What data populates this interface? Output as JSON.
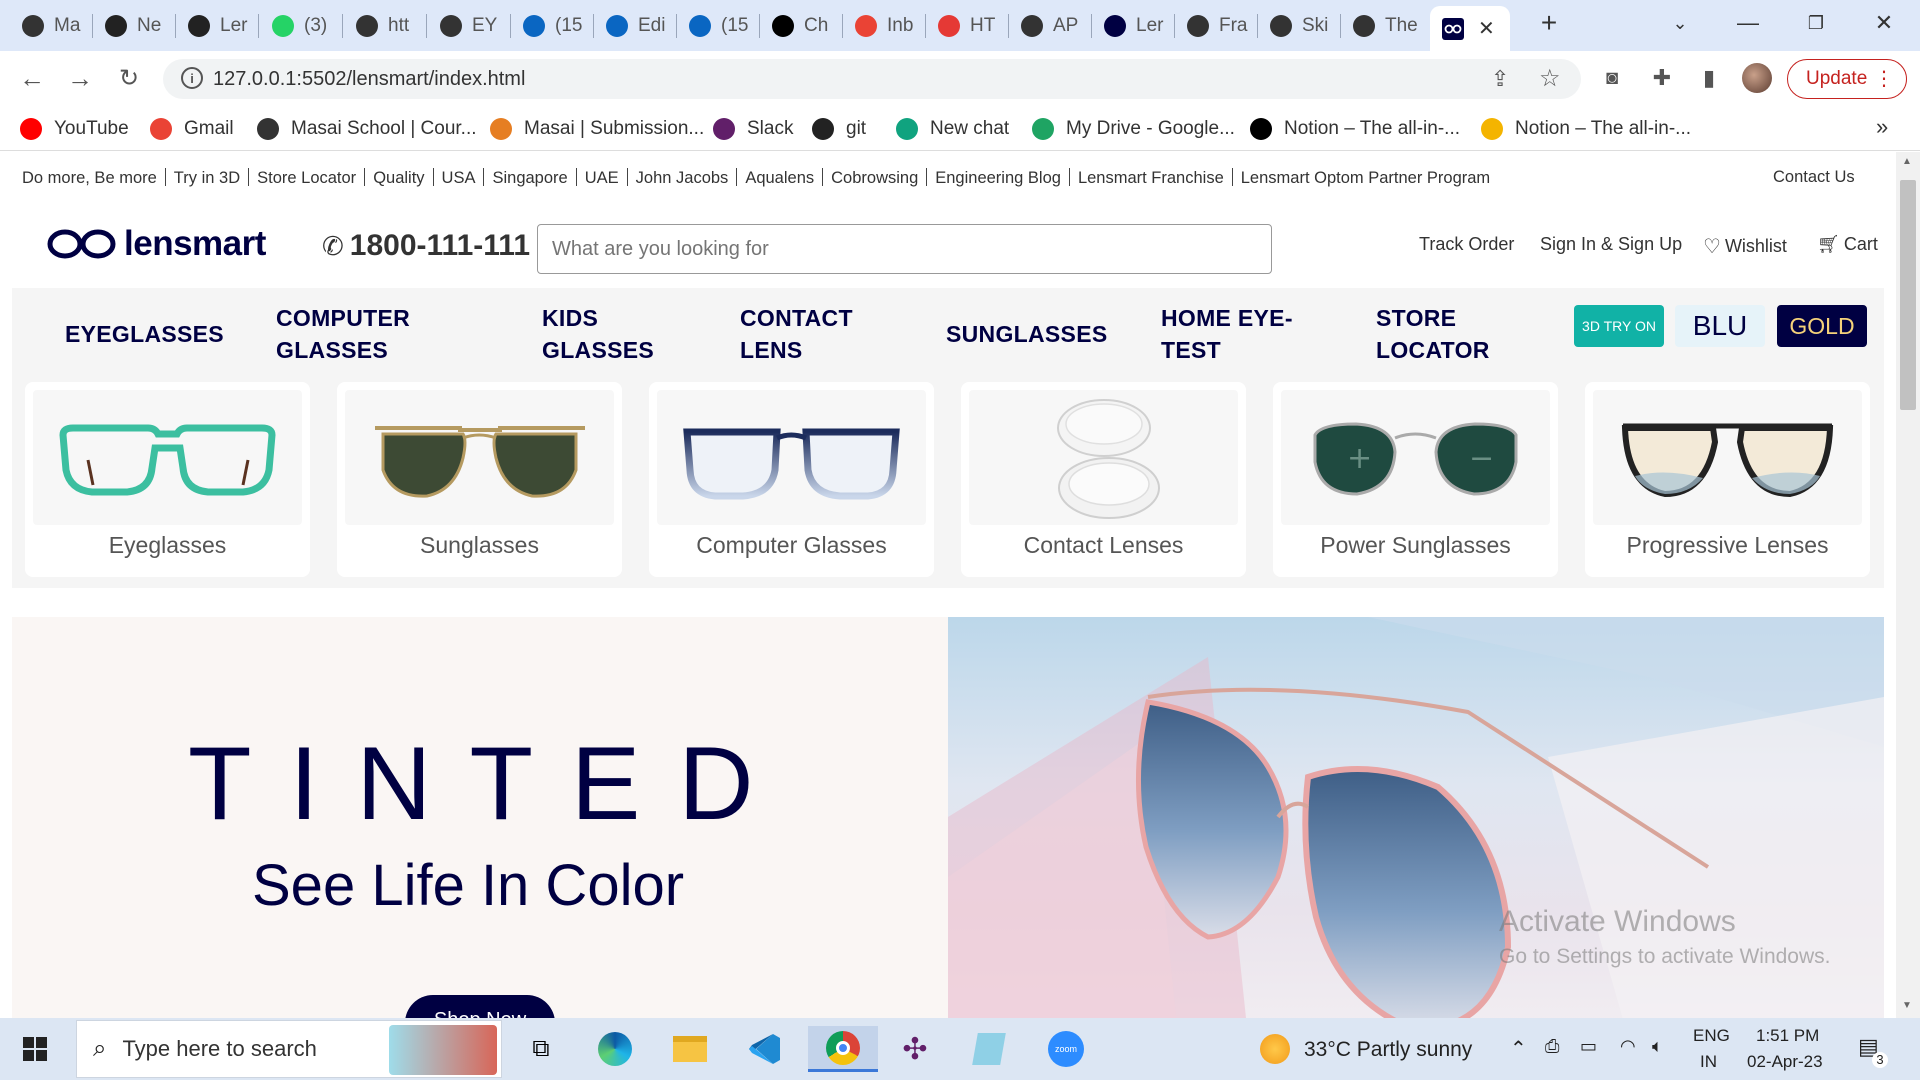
{
  "browser": {
    "tabs": [
      {
        "label": "Ma",
        "icon": "globe-icon",
        "color": "#333"
      },
      {
        "label": "Ne",
        "icon": "github-icon",
        "color": "#222"
      },
      {
        "label": "Ler",
        "icon": "github-icon",
        "color": "#222"
      },
      {
        "label": "(3)",
        "icon": "whatsapp-icon",
        "color": "#25d366"
      },
      {
        "label": "htt",
        "icon": "masai-icon",
        "color": "#333"
      },
      {
        "label": "EY",
        "icon": "globe-icon",
        "color": "#333"
      },
      {
        "label": "(15",
        "icon": "linkedin-icon",
        "color": "#0a66c2"
      },
      {
        "label": "Edi",
        "icon": "linkedin-icon",
        "color": "#0a66c2"
      },
      {
        "label": "(15",
        "icon": "linkedin-icon",
        "color": "#0a66c2"
      },
      {
        "label": "Ch",
        "icon": "lensmart-icon",
        "color": "#000"
      },
      {
        "label": "Inb",
        "icon": "gmail-icon",
        "color": "#ea4335"
      },
      {
        "label": "HT",
        "icon": "vivaldi-icon",
        "color": "#e53935"
      },
      {
        "label": "AP",
        "icon": "masai-icon",
        "color": "#333"
      },
      {
        "label": "Ler",
        "icon": "lensmart-icon",
        "color": "#000042"
      },
      {
        "label": "Fra",
        "icon": "globe-icon",
        "color": "#333"
      },
      {
        "label": "Ski",
        "icon": "globe-icon",
        "color": "#333"
      },
      {
        "label": "The",
        "icon": "globe-icon",
        "color": "#333"
      }
    ],
    "url": "127.0.0.1:5502/lensmart/index.html",
    "update_label": "Update",
    "bookmarks": [
      {
        "label": "YouTube",
        "icon": "youtube-icon",
        "color": "#ff0000"
      },
      {
        "label": "Gmail",
        "icon": "gmail-icon",
        "color": "#ea4335"
      },
      {
        "label": "Masai School | Cour...",
        "icon": "globe-icon",
        "color": "#333"
      },
      {
        "label": "Masai | Submission...",
        "icon": "kite-icon",
        "color": "#e67e22"
      },
      {
        "label": "Slack",
        "icon": "slack-icon",
        "color": "#611f69"
      },
      {
        "label": "git",
        "icon": "github-icon",
        "color": "#222"
      },
      {
        "label": "New chat",
        "icon": "chatgpt-icon",
        "color": "#10a37f"
      },
      {
        "label": "My Drive - Google...",
        "icon": "drive-icon",
        "color": "#1fa463"
      },
      {
        "label": "Notion – The all-in-...",
        "icon": "notion-icon",
        "color": "#000"
      },
      {
        "label": "Notion – The all-in-...",
        "icon": "avatar-icon",
        "color": "#f4b400"
      }
    ]
  },
  "site": {
    "top_links": [
      "Do more, Be more",
      "Try in 3D",
      "Store Locator",
      "Quality",
      "USA",
      "Singapore",
      "UAE",
      "John Jacobs",
      "Aqualens",
      "Cobrowsing",
      "Engineering Blog",
      "Lensmart Franchise",
      "Lensmart Optom Partner Program"
    ],
    "contact_us": "Contact Us",
    "logo_text": "lensmart",
    "phone": "1800-111-111",
    "search_placeholder": "What are you looking for",
    "track_order": "Track Order",
    "sign_in": "Sign In & Sign Up",
    "wishlist": "Wishlist",
    "cart": "Cart",
    "nav": [
      {
        "line1": "EYEGLASSES",
        "line2": ""
      },
      {
        "line1": "COMPUTER",
        "line2": "GLASSES"
      },
      {
        "line1": "KIDS",
        "line2": "GLASSES"
      },
      {
        "line1": "CONTACT",
        "line2": "LENS"
      },
      {
        "line1": "SUNGLASSES",
        "line2": ""
      },
      {
        "line1": "HOME EYE-",
        "line2": "TEST"
      },
      {
        "line1": "STORE",
        "line2": "LOCATOR"
      }
    ],
    "pills": {
      "try3d": "3D TRY ON",
      "blu": "BLU",
      "gold": "GOLD"
    },
    "categories": [
      "Eyeglasses",
      "Sunglasses",
      "Computer Glasses",
      "Contact Lenses",
      "Power Sunglasses",
      "Progressive Lenses"
    ],
    "hero": {
      "title": "TINTED",
      "subtitle": "See Life In Color",
      "cta": "Shop Now"
    },
    "watermark": {
      "line1": "Activate Windows",
      "line2": "Go to Settings to activate Windows."
    },
    "colors": {
      "brand_navy": "#000042",
      "teal": "#11b2a6",
      "blu_bg": "#e6f3f9"
    }
  },
  "taskbar": {
    "search_placeholder": "Type here to search",
    "weather": "33°C  Partly sunny",
    "lang1": "ENG",
    "lang2": "IN",
    "time": "1:51 PM",
    "date": "02-Apr-23",
    "notifications": "3"
  }
}
